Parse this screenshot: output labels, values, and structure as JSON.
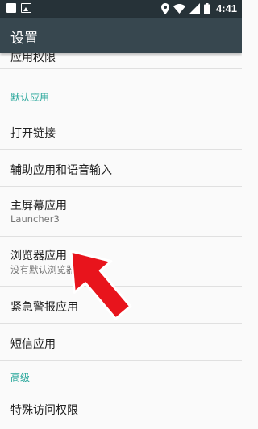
{
  "status_bar": {
    "time": "4:41",
    "icons": [
      "notification-icon",
      "image-icon",
      "location-icon",
      "wifi-icon",
      "signal-icon",
      "battery-icon"
    ]
  },
  "app_bar": {
    "title": "设置"
  },
  "list": {
    "app_permissions": "应用权限",
    "default_apps_header": "默认应用",
    "open_links": "打开链接",
    "assist_voice": "辅助应用和语音输入",
    "home_app": {
      "title": "主屏幕应用",
      "subtitle": "Launcher3"
    },
    "browser_app": {
      "title": "浏览器应用",
      "subtitle": "没有默认浏览器"
    },
    "emergency_alert": "紧急警报应用",
    "sms_app": "短信应用",
    "advanced_header": "高级",
    "special_access": "特殊访问权限"
  },
  "colors": {
    "status_bar": "#263238",
    "app_bar": "#37474f",
    "accent": "#26a69a",
    "arrow": "#e8141c"
  }
}
